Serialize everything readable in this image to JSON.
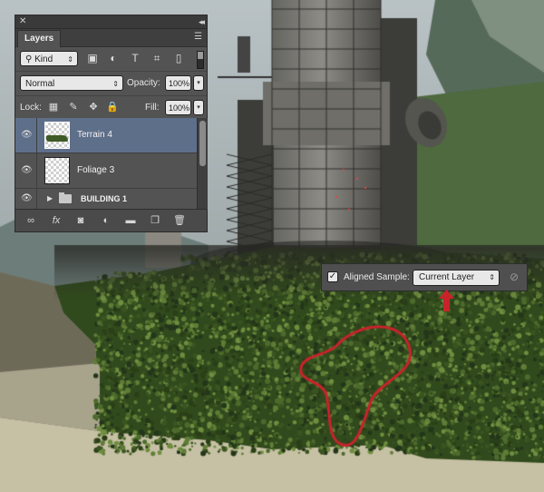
{
  "panel": {
    "close_glyph": "✕",
    "collapse_glyph": "◂◂",
    "menu_glyph": "☰",
    "tab_label": "Layers",
    "filter": {
      "kind_label": "Kind",
      "kind_glyph": "⚲",
      "icons": [
        "image-filter-icon",
        "adjustment-filter-icon",
        "type-filter-icon",
        "shape-filter-icon",
        "smart-object-filter-icon"
      ],
      "icon_glyphs": [
        "▣",
        "◐",
        "T",
        "⌗",
        "▯"
      ]
    },
    "blend_mode": "Normal",
    "opacity_label": "Opacity:",
    "opacity_value": "100%",
    "lock_label": "Lock:",
    "lock_glyphs": [
      "▦",
      "✎",
      "✥",
      "🔒"
    ],
    "fill_label": "Fill:",
    "fill_value": "100%",
    "dropdown_glyph": "▾",
    "eye_glyph": "👁",
    "caret_glyph": "▶",
    "layers": [
      {
        "name": "Terrain 4",
        "selected": true
      },
      {
        "name": "Foliage 3",
        "selected": false
      },
      {
        "name": "BUILDING 1",
        "group": true
      }
    ],
    "footer_glyphs": [
      "∞",
      "fx",
      "◙",
      "◐",
      "▬",
      "❐",
      "🗑"
    ]
  },
  "options_bar": {
    "checked": true,
    "check_glyph": "✓",
    "aligned_label": "Aligned",
    "sample_label": "Sample:",
    "sample_value": "Current Layer",
    "select_glyph": "⇕",
    "ignore_glyph": "⊘"
  },
  "colors": {
    "panel_bg": "#535353",
    "selected_layer": "#5e6f8a",
    "annotation_red": "#c8232b",
    "moss_green": "#3f5a25"
  }
}
